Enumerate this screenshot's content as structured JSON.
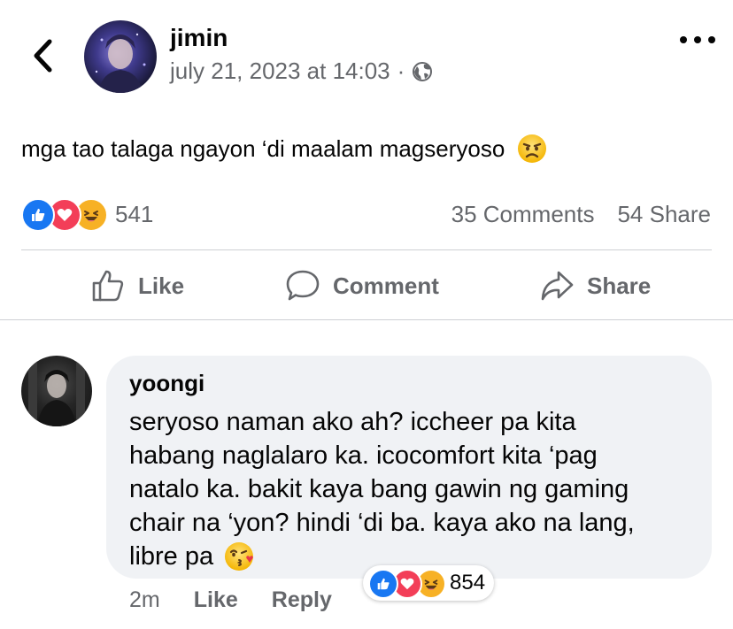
{
  "post": {
    "author": "jimin",
    "timestamp": "july 21, 2023 at 14:03",
    "separator": "·",
    "privacy_icon": "globe-icon",
    "text": "mga tao talaga ngayon ‘di maalam magseryoso",
    "emoji": "angry-face",
    "reaction_count": "541",
    "comments_count": "35 Comments",
    "shares_count": "54 Share"
  },
  "actions": {
    "like_label": "Like",
    "comment_label": "Comment",
    "share_label": "Share"
  },
  "comment": {
    "author": "yoongi",
    "lines": [
      "seryoso naman ako ah? iccheer pa kita",
      "habang naglalaro ka. icocomfort kita ‘pag",
      "natalo ka. bakit kaya bang gawin ng gaming",
      "chair na ‘yon? hindi ‘di ba. kaya ako na lang,",
      "libre pa"
    ],
    "emoji": "face-blowing-a-kiss",
    "time": "2m",
    "like_label": "Like",
    "reply_label": "Reply",
    "reaction_count": "854"
  },
  "colors": {
    "like_blue": "#1877f2",
    "love_red": "#f33e58",
    "haha_yellow": "#f7b125",
    "muted_text": "#65676b",
    "bubble_bg": "#f0f2f5"
  }
}
